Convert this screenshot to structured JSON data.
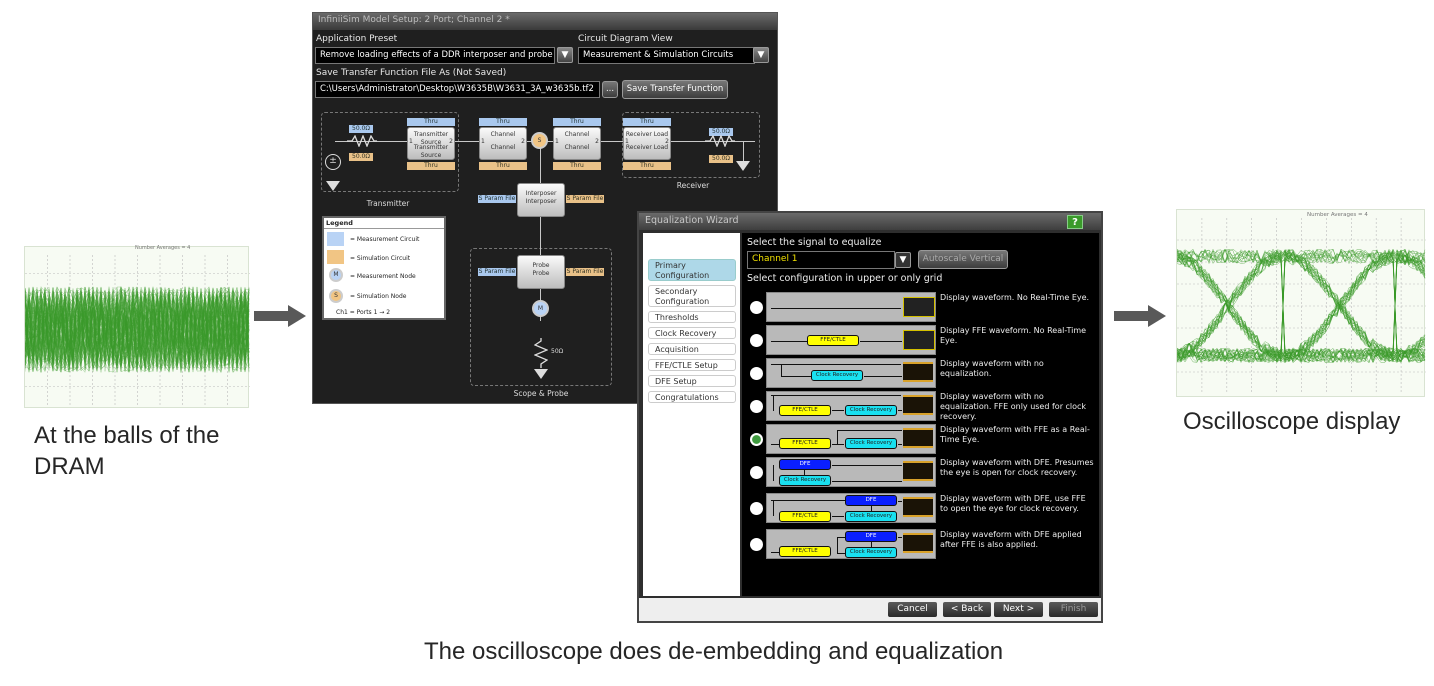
{
  "captions": {
    "left": "At the balls of the DRAM",
    "right": "Oscilloscope display",
    "bottom": "The oscilloscope does de-embedding and equalization"
  },
  "eye_left": {
    "header": "Number Averages = 4"
  },
  "eye_right": {
    "header": "Number Averages = 4"
  },
  "colors": {
    "eye_trace": "#3a9a2a",
    "arrow": "#595959",
    "measurement": "#a9c8ee",
    "simulation": "#e9c188"
  },
  "infiniisim": {
    "title": "InfiniiSim Model Setup: 2 Port; Channel 2 *",
    "application_preset_label": "Application Preset",
    "application_preset_value": "Remove loading effects of a DDR interposer and probe",
    "circuit_view_label": "Circuit Diagram View",
    "circuit_view_value": "Measurement & Simulation Circuits",
    "save_label": "Save Transfer Function File As (Not Saved)",
    "save_path": "C:\\Users\\Administrator\\Desktop\\W3635B\\W3631_3A_w3635b.tf2",
    "browse_label": "...",
    "save_button": "Save Transfer Function",
    "diagram": {
      "tx_res_meas": "50.0Ω",
      "tx_res_sim": "50.0Ω",
      "rx_res_meas": "50.0Ω",
      "rx_res_sim": "50.0Ω",
      "thru": "Thru",
      "blocks": [
        {
          "name": "Transmitter Source",
          "top": "Transmitter Source",
          "bottom": "Transmitter Source"
        },
        {
          "name": "Channel",
          "top": "Channel",
          "bottom": "Channel"
        },
        {
          "name": "Channel",
          "top": "Channel",
          "bottom": "Channel"
        },
        {
          "name": "Receiver Load",
          "top": "Receiver Load",
          "bottom": "Receiver Load"
        }
      ],
      "port1": "1",
      "port2": "2",
      "interposer": "Interposer",
      "probe": "Probe",
      "sparam": "S Param File",
      "sim_node": "S",
      "meas_node": "M",
      "probe_res": "50Ω",
      "transmitter_label": "Transmitter",
      "receiver_label": "Receiver",
      "scope_label": "Scope & Probe"
    },
    "legend": {
      "title": "Legend",
      "items": [
        "= Measurement Circuit",
        "= Simulation Circuit",
        "= Measurement Node",
        "= Simulation Node"
      ],
      "ports": "Ch1 = Ports 1 → 2"
    }
  },
  "wizard": {
    "title": "Equalization Wizard",
    "help": "?",
    "nav": [
      {
        "label": "Primary Configuration",
        "active": true
      },
      {
        "label": "Secondary Configuration",
        "active": false
      },
      {
        "label": "Thresholds",
        "active": false
      },
      {
        "label": "Clock Recovery",
        "active": false
      },
      {
        "label": "Acquisition",
        "active": false
      },
      {
        "label": "FFE/CTLE Setup",
        "active": false
      },
      {
        "label": "DFE Setup",
        "active": false
      },
      {
        "label": "Congratulations",
        "active": false
      }
    ],
    "signal_label": "Select the signal to equalize",
    "signal_value": "Channel 1",
    "autoscale": "Autoscale Vertical",
    "grid_label": "Select configuration in upper or only grid",
    "block_labels": {
      "ffe": "FFE/CTLE",
      "cr": "Clock Recovery",
      "dfe": "DFE"
    },
    "options": [
      {
        "text": "Display waveform. No Real-Time Eye.",
        "selected": false
      },
      {
        "text": "Display FFE waveform. No Real-Time Eye.",
        "selected": false
      },
      {
        "text": "Display waveform with no equalization.",
        "selected": false
      },
      {
        "text": "Display waveform with no equalization. FFE only used for clock recovery.",
        "selected": false
      },
      {
        "text": "Display waveform with FFE as a Real-Time Eye.",
        "selected": true
      },
      {
        "text": "Display waveform with DFE. Presumes the eye is open for clock recovery.",
        "selected": false
      },
      {
        "text": "Display waveform with DFE, use FFE to open the eye for clock recovery.",
        "selected": false
      },
      {
        "text": "Display waveform with DFE applied after FFE is also applied.",
        "selected": false
      }
    ],
    "buttons": {
      "cancel": "Cancel",
      "back": "< Back",
      "next": "Next >",
      "finish": "Finish"
    }
  }
}
